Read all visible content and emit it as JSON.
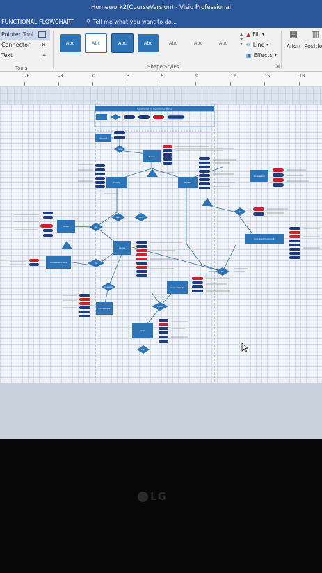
{
  "window": {
    "title": "Homework2(CourseVersion) - Visio Professional"
  },
  "tabbar": {
    "active_tab": "FUNCTIONAL FLOWCHART",
    "tell_me": "Tell me what you want to do..."
  },
  "ribbon": {
    "tools": {
      "pointer": "Pointer Tool",
      "connector": "Connector",
      "text": "Text",
      "group_label": "Tools"
    },
    "shape_styles": {
      "swatch_label": "Abc",
      "group_label": "Shape Styles"
    },
    "format": {
      "fill": "Fill",
      "line": "Line",
      "effects": "Effects"
    },
    "arrange": {
      "align": "Align",
      "position": "Position"
    }
  },
  "ruler": {
    "marks": [
      "-6",
      "-3",
      "0",
      "3",
      "6",
      "9",
      "12",
      "15",
      "18"
    ]
  },
  "diagram": {
    "header_title": "Relational to Relational Data",
    "entities": [
      "Account",
      "Person",
      "Faculty",
      "Student",
      "Worksession",
      "Group",
      "Course",
      "CourseSectionAccount",
      "CourseInstructions",
      "SessionPeriods",
      "CourseGrade",
      "Unit"
    ],
    "relations": [
      "Login",
      "Teach",
      "Enroll",
      "Has",
      "Has",
      "Has",
      "Has",
      "CourseFile",
      "Reply",
      "Create"
    ]
  },
  "monitor": {
    "brand": "LG"
  },
  "colors": {
    "title_bg": "#2b579a",
    "entity": "#2e74b5",
    "attribute_red": "#c0262d",
    "attribute_navy": "#1f3b78"
  }
}
